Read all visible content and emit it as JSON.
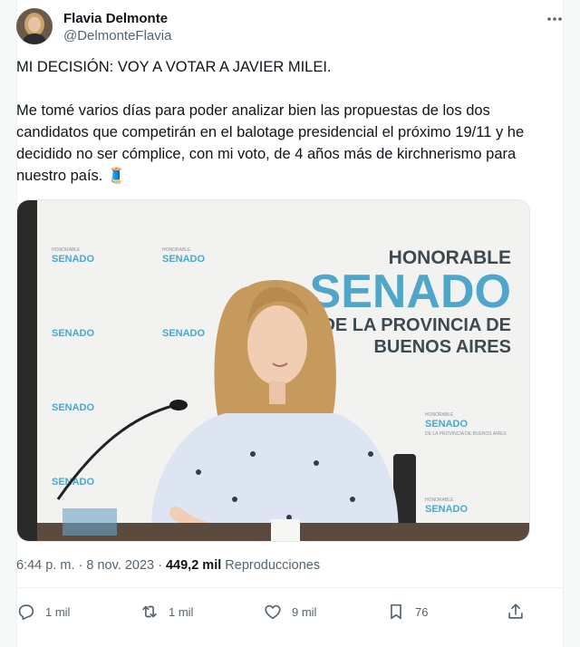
{
  "author": {
    "name": "Flavia Delmonte",
    "handle": "@DelmonteFlavia"
  },
  "post": {
    "headline": "MI DECISIÓN: VOY A VOTAR A JAVIER MILEI.",
    "body": "Me tomé varios días para poder analizar bien las propuestas de los dos candidatos que competirán en el balotage presidencial el próximo 19/11 y he decidido no ser cómplice, con mi voto, de 4 años más de kirchnerismo para nuestro país. 🧵",
    "image_text": {
      "banner_line1": "HONORABLE",
      "banner_line2": "SENADO",
      "banner_line3": "DE LA PROVINCIA DE",
      "banner_line4": "BUENOS AIRES",
      "logo_small_1": "HONORABLE",
      "logo_small_2": "SENADO",
      "logo_small_3": "DE LA PROVINCIA DE BUENOS AIRES"
    }
  },
  "meta": {
    "time": "6:44 p. m.",
    "dot": " · ",
    "date": "8 nov. 2023",
    "dot2": " · ",
    "views": "449,2 mil",
    "views_label": "Reproducciones"
  },
  "actions": {
    "replies": "1 mil",
    "reposts": "1 mil",
    "likes": "9 mil",
    "bookmarks": "76"
  },
  "colors": {
    "text": "#0f1419",
    "muted": "#536471",
    "senado_blue": "#4fa6c9",
    "senado_gray": "#3e4a52"
  }
}
